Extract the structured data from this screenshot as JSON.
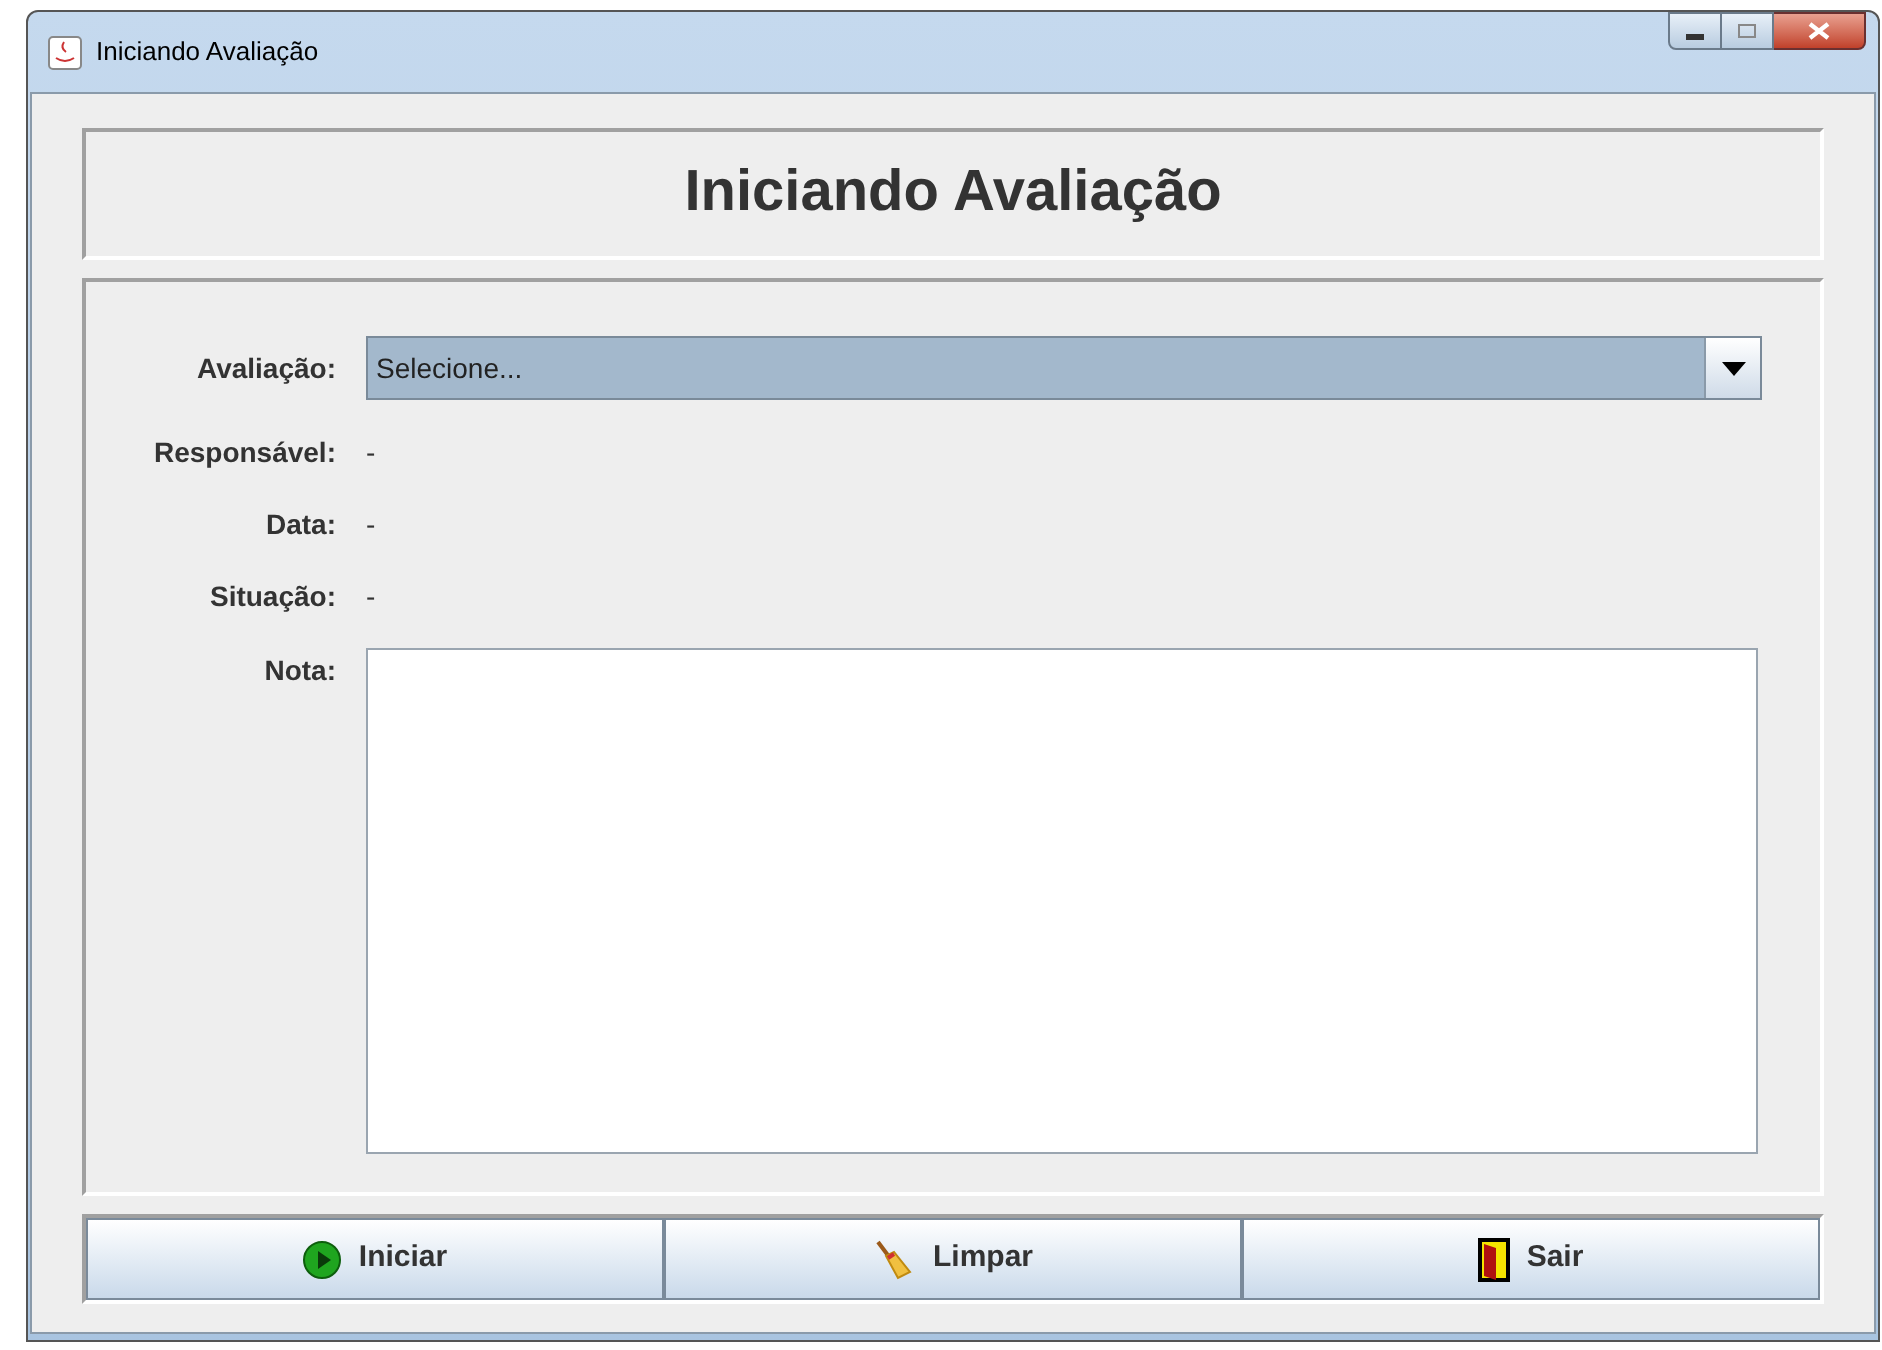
{
  "window": {
    "title": "Iniciando Avaliação"
  },
  "header": {
    "title": "Iniciando Avaliação"
  },
  "fields": [
    {
      "kind": "combo",
      "label": "Avaliação:",
      "value": "Selecione..."
    },
    {
      "kind": "text",
      "label": "Responsável:",
      "value": "-"
    },
    {
      "kind": "text",
      "label": "Data:",
      "value": "-"
    },
    {
      "kind": "text",
      "label": "Situação:",
      "value": "-"
    },
    {
      "kind": "textarea",
      "label": "Nota:"
    }
  ],
  "buttons": [
    {
      "label": "Iniciar",
      "kind": "play"
    },
    {
      "label": "Limpar",
      "kind": "broom"
    },
    {
      "label": "Sair",
      "kind": "door"
    }
  ]
}
